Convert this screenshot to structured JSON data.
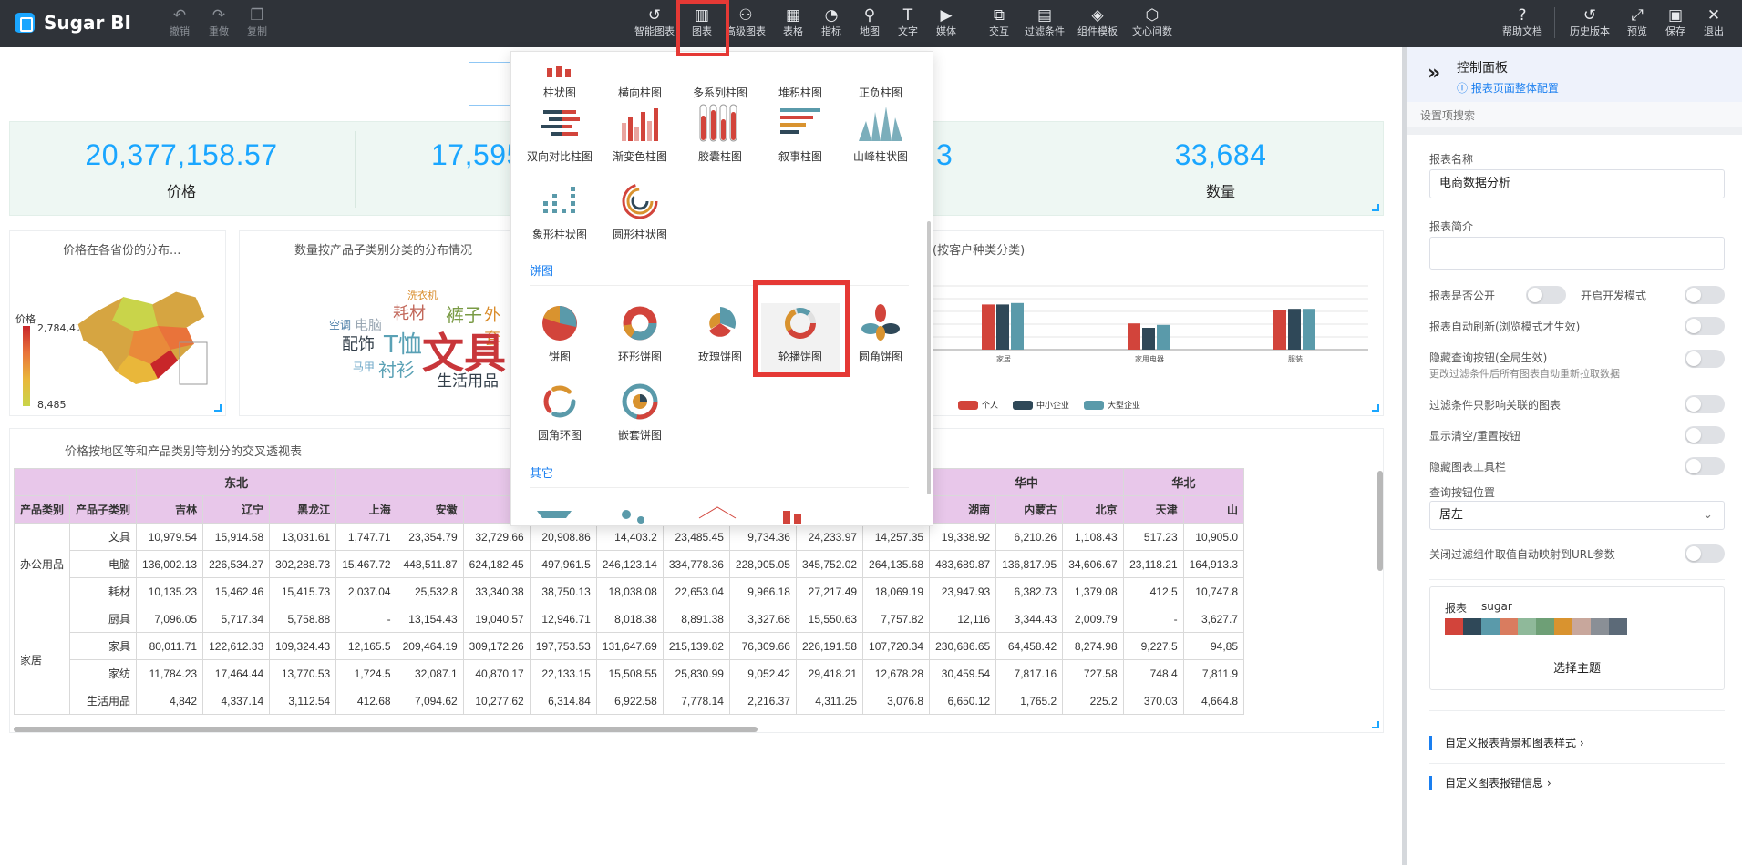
{
  "app": {
    "name": "Sugar BI"
  },
  "toolbar_left": [
    {
      "label": "撤销",
      "icon": "undo-icon"
    },
    {
      "label": "重做",
      "icon": "redo-icon"
    },
    {
      "label": "复制",
      "icon": "copy-icon"
    }
  ],
  "toolbar_center": [
    {
      "label": "智能图表",
      "icon": "smart-chart-icon"
    },
    {
      "label": "图表",
      "icon": "bar-chart-icon"
    },
    {
      "label": "高级图表",
      "icon": "advanced-chart-icon"
    },
    {
      "label": "表格",
      "icon": "table-icon"
    },
    {
      "label": "指标",
      "icon": "gauge-icon"
    },
    {
      "label": "地图",
      "icon": "map-pin-icon"
    },
    {
      "label": "文字",
      "icon": "text-icon"
    },
    {
      "label": "媒体",
      "icon": "media-icon"
    },
    {
      "label": "交互",
      "icon": "interaction-icon"
    },
    {
      "label": "过滤条件",
      "icon": "filter-icon"
    },
    {
      "label": "组件模板",
      "icon": "template-icon"
    },
    {
      "label": "文心问数",
      "icon": "wenxin-icon"
    }
  ],
  "toolbar_right": [
    {
      "label": "帮助文档",
      "icon": "help-icon"
    },
    {
      "label": "历史版本",
      "icon": "history-icon"
    },
    {
      "label": "预览",
      "icon": "expand-icon"
    },
    {
      "label": "保存",
      "icon": "save-icon"
    },
    {
      "label": "退出",
      "icon": "close-icon"
    }
  ],
  "kpis": [
    {
      "value": "20,377,158.57",
      "name": "价格"
    },
    {
      "value": "17,595",
      "name": ""
    },
    {
      "value": "3",
      "name": ""
    },
    {
      "value": "33,684",
      "name": "数量"
    }
  ],
  "map_card": {
    "title": "价格在各省份的分布...",
    "legend_title": "价格",
    "max": "2,784,471",
    "min": "8,485"
  },
  "wordcloud_card": {
    "title": "数量按产品子类别分类的分布情况",
    "words": [
      {
        "text": "洗衣机",
        "color": "#d98c2b"
      },
      {
        "text": "耗材",
        "color": "#c2675a"
      },
      {
        "text": "裤子",
        "color": "#7a9b45"
      },
      {
        "text": "外套",
        "color": "#d98c2b"
      },
      {
        "text": "空调",
        "color": "#4d7fa8"
      },
      {
        "text": "电脑",
        "color": "#9aa7b3"
      },
      {
        "text": "配饰",
        "color": "#333f4a"
      },
      {
        "text": "T恤",
        "color": "#5aa1b5"
      },
      {
        "text": "文具",
        "color": "#c8363a"
      },
      {
        "text": "马甲",
        "color": "#6fa8c8"
      },
      {
        "text": "衬衫",
        "color": "#5aa1b5"
      },
      {
        "text": "生活用品",
        "color": "#333f4a"
      }
    ]
  },
  "bar_card": {
    "title": "(按客户种类分类)",
    "legend": [
      {
        "name": "个人",
        "color": "#d2443b"
      },
      {
        "name": "中小企业",
        "color": "#2f4858"
      },
      {
        "name": "大型企业",
        "color": "#5a9aaa"
      }
    ]
  },
  "chart_data": {
    "type": "bar",
    "categories": [
      "家居",
      "家用电器",
      "服装"
    ],
    "series": [
      {
        "name": "个人",
        "values": [
          62,
          36,
          54
        ]
      },
      {
        "name": "中小企业",
        "values": [
          62,
          30,
          56
        ]
      },
      {
        "name": "大型企业",
        "values": [
          64,
          34,
          56
        ]
      }
    ]
  },
  "pivot": {
    "title": "价格按地区等和产品类别等划分的交叉透视表",
    "regions": [
      {
        "name": "东北",
        "span": 3
      },
      {
        "name": "",
        "span": 9
      },
      {
        "name": "华中",
        "span": 3
      },
      {
        "name": "华北",
        "span": 4
      }
    ],
    "row_headers": [
      "产品类别",
      "产品子类别"
    ],
    "provinces": [
      "吉林",
      "辽宁",
      "黑龙江",
      "上海",
      "安徽",
      "",
      "",
      "",
      "",
      "",
      "河南",
      "湖北",
      "湖南",
      "内蒙古",
      "北京",
      "天津",
      "山"
    ],
    "groups": [
      {
        "category": "办公用品",
        "rows": [
          {
            "sub": "文具",
            "vals": [
              "10,979.54",
              "15,914.58",
              "13,031.61",
              "1,747.71",
              "23,354.79",
              "32,729.66",
              "20,908.86",
              "14,403.2",
              "23,485.45",
              "9,734.36",
              "24,233.97",
              "14,257.35",
              "19,338.92",
              "6,210.26",
              "1,108.43",
              "517.23",
              "10,905.0"
            ]
          },
          {
            "sub": "电脑",
            "vals": [
              "136,002.13",
              "226,534.27",
              "302,288.73",
              "15,467.72",
              "448,511.87",
              "624,182.45",
              "497,961.5",
              "246,123.14",
              "334,778.36",
              "228,905.05",
              "345,752.02",
              "264,135.68",
              "483,689.87",
              "136,817.95",
              "34,606.67",
              "23,118.21",
              "164,913.3"
            ]
          },
          {
            "sub": "耗材",
            "vals": [
              "10,135.23",
              "15,462.46",
              "15,415.73",
              "2,037.04",
              "25,532.8",
              "33,340.38",
              "38,750.13",
              "18,038.08",
              "22,653.04",
              "9,966.18",
              "27,217.49",
              "18,069.19",
              "23,947.93",
              "6,382.73",
              "1,379.08",
              "412.5",
              "10,747.8"
            ]
          }
        ]
      },
      {
        "category": "家居",
        "rows": [
          {
            "sub": "厨具",
            "vals": [
              "7,096.05",
              "5,717.34",
              "5,758.88",
              "-",
              "13,154.43",
              "19,040.57",
              "12,946.71",
              "8,018.38",
              "8,891.38",
              "3,327.68",
              "15,550.63",
              "7,757.82",
              "12,116",
              "3,344.43",
              "2,009.79",
              "-",
              "3,627.7"
            ]
          },
          {
            "sub": "家具",
            "vals": [
              "80,011.71",
              "122,612.33",
              "109,324.43",
              "12,165.5",
              "209,464.19",
              "309,172.26",
              "197,753.53",
              "131,647.69",
              "215,139.82",
              "76,309.66",
              "226,191.58",
              "107,720.34",
              "230,686.65",
              "64,458.42",
              "8,274.98",
              "9,227.5",
              "94,85"
            ]
          },
          {
            "sub": "家纺",
            "vals": [
              "11,784.23",
              "17,464.44",
              "13,770.53",
              "1,724.5",
              "32,087.1",
              "40,870.17",
              "22,133.15",
              "15,508.55",
              "25,830.99",
              "9,052.42",
              "29,418.21",
              "12,678.28",
              "30,459.54",
              "7,817.16",
              "727.58",
              "748.4",
              "7,811.9"
            ]
          },
          {
            "sub": "生活用品",
            "vals": [
              "4,842",
              "4,337.14",
              "3,112.54",
              "412.68",
              "7,094.62",
              "10,277.62",
              "6,314.84",
              "6,922.58",
              "7,778.14",
              "2,216.37",
              "4,311.25",
              "3,076.8",
              "6,650.12",
              "1,765.2",
              "225.2",
              "370.03",
              "4,664.8"
            ]
          }
        ]
      }
    ]
  },
  "chart_menu": {
    "top_row": [
      "柱状图",
      "横向柱图",
      "多系列柱图",
      "堆积柱图",
      "正负柱图"
    ],
    "bar_items": [
      "双向对比柱图",
      "渐变色柱图",
      "胶囊柱图",
      "叙事柱图",
      "山峰柱状图",
      "象形柱状图",
      "圆形柱状图"
    ],
    "pie_section": "饼图",
    "pie_items": [
      "饼图",
      "环形饼图",
      "玫瑰饼图",
      "轮播饼图",
      "圆角饼图",
      "圆角环图",
      "嵌套饼图"
    ],
    "other_section": "其它"
  },
  "panel": {
    "title": "控制面板",
    "link": "报表页面整体配置",
    "search_placeholder": "设置项搜索",
    "report_name_label": "报表名称",
    "report_name": "电商数据分析",
    "report_desc_label": "报表简介",
    "report_desc": "",
    "public_label": "报表是否公开",
    "dev_label": "开启开发模式",
    "auto_refresh_label": "报表自动刷新(浏览模式才生效)",
    "hide_query_label": "隐藏查询按钮(全局生效)",
    "hide_query_hint": "更改过滤条件后所有图表自动重新拉取数据",
    "filter_assoc_label": "过滤条件只影响关联的图表",
    "show_clear_label": "显示清空/重置按钮",
    "hide_toolbar_label": "隐藏图表工具栏",
    "query_pos_label": "查询按钮位置",
    "query_pos_value": "居左",
    "url_param_label": "关闭过滤组件取值自动映射到URL参数",
    "theme_title": "报表",
    "theme_name": "sugar",
    "theme_colors": [
      "#d2443b",
      "#2f4858",
      "#5a9aaa",
      "#d97c5f",
      "#8fb99a",
      "#6e9f76",
      "#d9932f",
      "#c8a79c",
      "#8a8f96",
      "#5c6a78"
    ],
    "theme_button": "选择主题",
    "bg_link": "自定义报表背景和图表样式",
    "err_link": "自定义图表报错信息"
  }
}
